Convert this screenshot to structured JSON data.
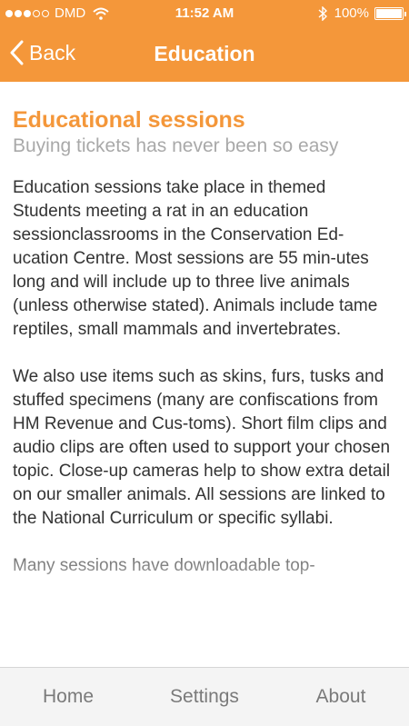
{
  "status_bar": {
    "carrier": "DMD",
    "time": "11:52 AM",
    "battery": "100%",
    "signal_dots_filled": 3,
    "signal_dots_total": 5,
    "icons": [
      "wifi-icon",
      "bluetooth-icon",
      "battery-icon"
    ]
  },
  "nav": {
    "back_label": "Back",
    "title": "Education",
    "color": "#f4973a"
  },
  "content": {
    "title": "Educational sessions",
    "subtitle": "Buying tickets has never been so easy",
    "paragraphs": [
      "Education sessions take place in themed Students meeting a rat in an education sessionclassrooms in the Conservation Ed-ucation Centre. Most sessions are 55 min-utes long and will include up to three live animals (unless otherwise stated). Animals include tame reptiles, small mammals and invertebrates.",
      "We also use items such as skins, furs, tusks and stuffed specimens (many are confiscations from HM Revenue and Cus-toms). Short film clips and audio clips are often used to support your chosen topic. Close-up cameras help to show extra detail on our smaller animals. All sessions are linked to the National Curriculum or specific syllabi.",
      "Many sessions have downloadable top-"
    ]
  },
  "tabs": {
    "home": "Home",
    "settings": "Settings",
    "about": "About"
  }
}
